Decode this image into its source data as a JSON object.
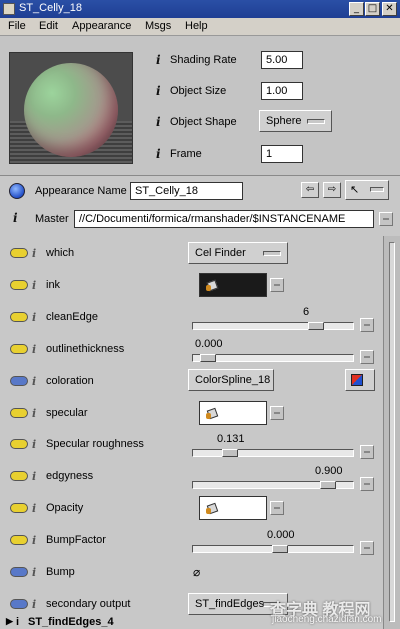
{
  "window": {
    "title": "ST_Celly_18"
  },
  "window_controls": {
    "minimize": "_",
    "maximize": "□",
    "close": "✕"
  },
  "menu": [
    "File",
    "Edit",
    "Appearance",
    "Msgs",
    "Help"
  ],
  "info_glyph": "i",
  "top_params": {
    "shading_rate": {
      "label": "Shading Rate",
      "value": "5.00"
    },
    "object_size": {
      "label": "Object Size",
      "value": "1.00"
    },
    "object_shape": {
      "label": "Object Shape",
      "value": "Sphere"
    },
    "frame": {
      "label": "Frame",
      "value": "1"
    }
  },
  "appearance": {
    "label": "Appearance Name",
    "value": "ST_Celly_18"
  },
  "master": {
    "label": "Master",
    "value": "//C/Documenti/formica/rmanshader/$INSTANCENAME"
  },
  "nav": {
    "back": "⇦",
    "forward": "⇨",
    "pointer": "↖"
  },
  "params": [
    {
      "label": "which",
      "swatch": "yellow",
      "control": "option",
      "value": "Cel Finder"
    },
    {
      "label": "ink",
      "swatch": "yellow",
      "control": "texture",
      "value": ""
    },
    {
      "label": "cleanEdge",
      "swatch": "yellow",
      "control": "slider",
      "value": "6",
      "position": 0.8
    },
    {
      "label": "outlinethickness",
      "swatch": "yellow",
      "control": "slider",
      "value": "0.000",
      "position": 0.05
    },
    {
      "label": "coloration",
      "swatch": "blue",
      "control": "option",
      "value": "ColorSpline_18"
    },
    {
      "label": "specular",
      "swatch": "yellow",
      "control": "texture",
      "value": ""
    },
    {
      "label": "Specular roughness",
      "swatch": "yellow",
      "control": "slider",
      "value": "0.131",
      "position": 0.2
    },
    {
      "label": "edgyness",
      "swatch": "yellow",
      "control": "slider",
      "value": "0.900",
      "position": 0.88
    },
    {
      "label": "Opacity",
      "swatch": "yellow",
      "control": "texture",
      "value": ""
    },
    {
      "label": "BumpFactor",
      "swatch": "yellow",
      "control": "slider",
      "value": "0.000",
      "position": 0.55
    },
    {
      "label": "Bump",
      "swatch": "blue",
      "control": "link",
      "value": ""
    },
    {
      "label": "secondary output",
      "swatch": "blue",
      "control": "option",
      "value": "ST_findEdges"
    }
  ],
  "bottom_item": "ST_findEdges_4",
  "watermark": {
    "line1": "查字典 教程网",
    "line2": "jiaocheng.chazidian.com"
  },
  "colors": {
    "titlebar": "#2a4fa6",
    "panel": "#c8c8c8",
    "swatch_yellow": "#e8d030",
    "swatch_blue": "#5878c8"
  }
}
